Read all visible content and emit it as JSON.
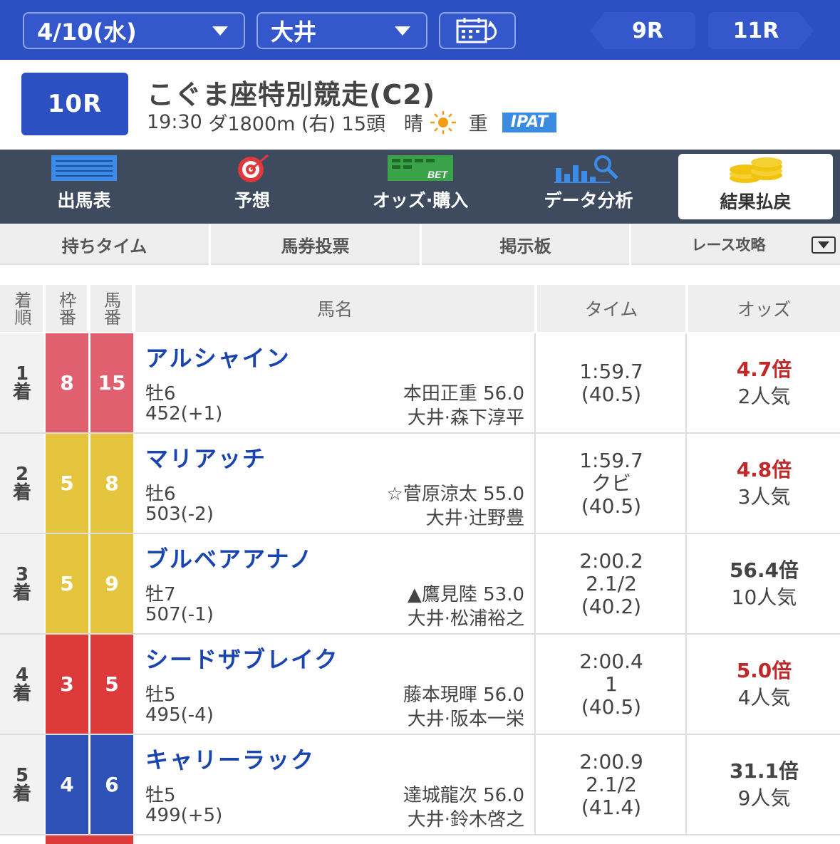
{
  "topbar": {
    "date": "4/10(水)",
    "venue": "大井",
    "prev_race": "9R",
    "next_race": "11R"
  },
  "race": {
    "number": "10R",
    "title": "こぐま座特別競走(C2)",
    "time": "19:30",
    "course": "ダ1800m (右)",
    "heads": "15頭",
    "weather": "晴",
    "track": "重",
    "ipat": "IPAT"
  },
  "main_nav": [
    {
      "label": "出馬表",
      "icon": "race-card-icon"
    },
    {
      "label": "予想",
      "icon": "target-icon"
    },
    {
      "label": "オッズ·購入",
      "icon": "bet-icon"
    },
    {
      "label": "データ分析",
      "icon": "chart-search-icon"
    },
    {
      "label": "結果払戻",
      "icon": "coins-icon",
      "active": true
    }
  ],
  "sub_nav": [
    "持ちタイム",
    "馬券投票",
    "掲示板",
    "レース攻略"
  ],
  "table": {
    "headers": {
      "pos": "着順",
      "waku": "枠番",
      "uma": "馬番",
      "name": "馬名",
      "time": "タイム",
      "odds": "オッズ"
    },
    "rows": [
      {
        "pos": "1",
        "pos_suffix": "着",
        "waku": "8",
        "uma": "15",
        "waku_color": "#e06070",
        "name": "アルシャイン",
        "sexage": "牡6",
        "jockey": "本田正重 56.0",
        "weight": "452(+1)",
        "trainer": "大井·森下淳平",
        "time": "1:59.7",
        "margin": "",
        "last3f": "(40.5)",
        "odds": "4.7倍",
        "pop": "2人気",
        "odds_red": true
      },
      {
        "pos": "2",
        "pos_suffix": "着",
        "waku": "5",
        "uma": "8",
        "waku_color": "#e6c53e",
        "name": "マリアッチ",
        "sexage": "牡6",
        "jockey": "☆菅原涼太 55.0",
        "weight": "503(-2)",
        "trainer": "大井·辻野豊",
        "time": "1:59.7",
        "margin": "クビ",
        "last3f": "(40.5)",
        "odds": "4.8倍",
        "pop": "3人気",
        "odds_red": true
      },
      {
        "pos": "3",
        "pos_suffix": "着",
        "waku": "5",
        "uma": "9",
        "waku_color": "#e6c53e",
        "name": "ブルベアアナノ",
        "sexage": "牡7",
        "jockey": "▲鷹見陸 53.0",
        "weight": "507(-1)",
        "trainer": "大井·松浦裕之",
        "time": "2:00.2",
        "margin": "2.1/2",
        "last3f": "(40.2)",
        "odds": "56.4倍",
        "pop": "10人気",
        "odds_red": false
      },
      {
        "pos": "4",
        "pos_suffix": "着",
        "waku": "3",
        "uma": "5",
        "waku_color": "#dd3b3b",
        "name": "シードザブレイク",
        "sexage": "牡5",
        "jockey": "藤本現暉 56.0",
        "weight": "495(-4)",
        "trainer": "大井·阪本一栄",
        "time": "2:00.4",
        "margin": "1",
        "last3f": "(40.5)",
        "odds": "5.0倍",
        "pop": "4人気",
        "odds_red": true
      },
      {
        "pos": "5",
        "pos_suffix": "着",
        "waku": "4",
        "uma": "6",
        "waku_color": "#2f52b8",
        "name": "キャリーラック",
        "sexage": "牡5",
        "jockey": "達城龍次 56.0",
        "weight": "499(+5)",
        "trainer": "大井·鈴木啓之",
        "time": "2:00.9",
        "margin": "2.1/2",
        "last3f": "(41.4)",
        "odds": "31.1倍",
        "pop": "9人気",
        "odds_red": false
      }
    ]
  }
}
